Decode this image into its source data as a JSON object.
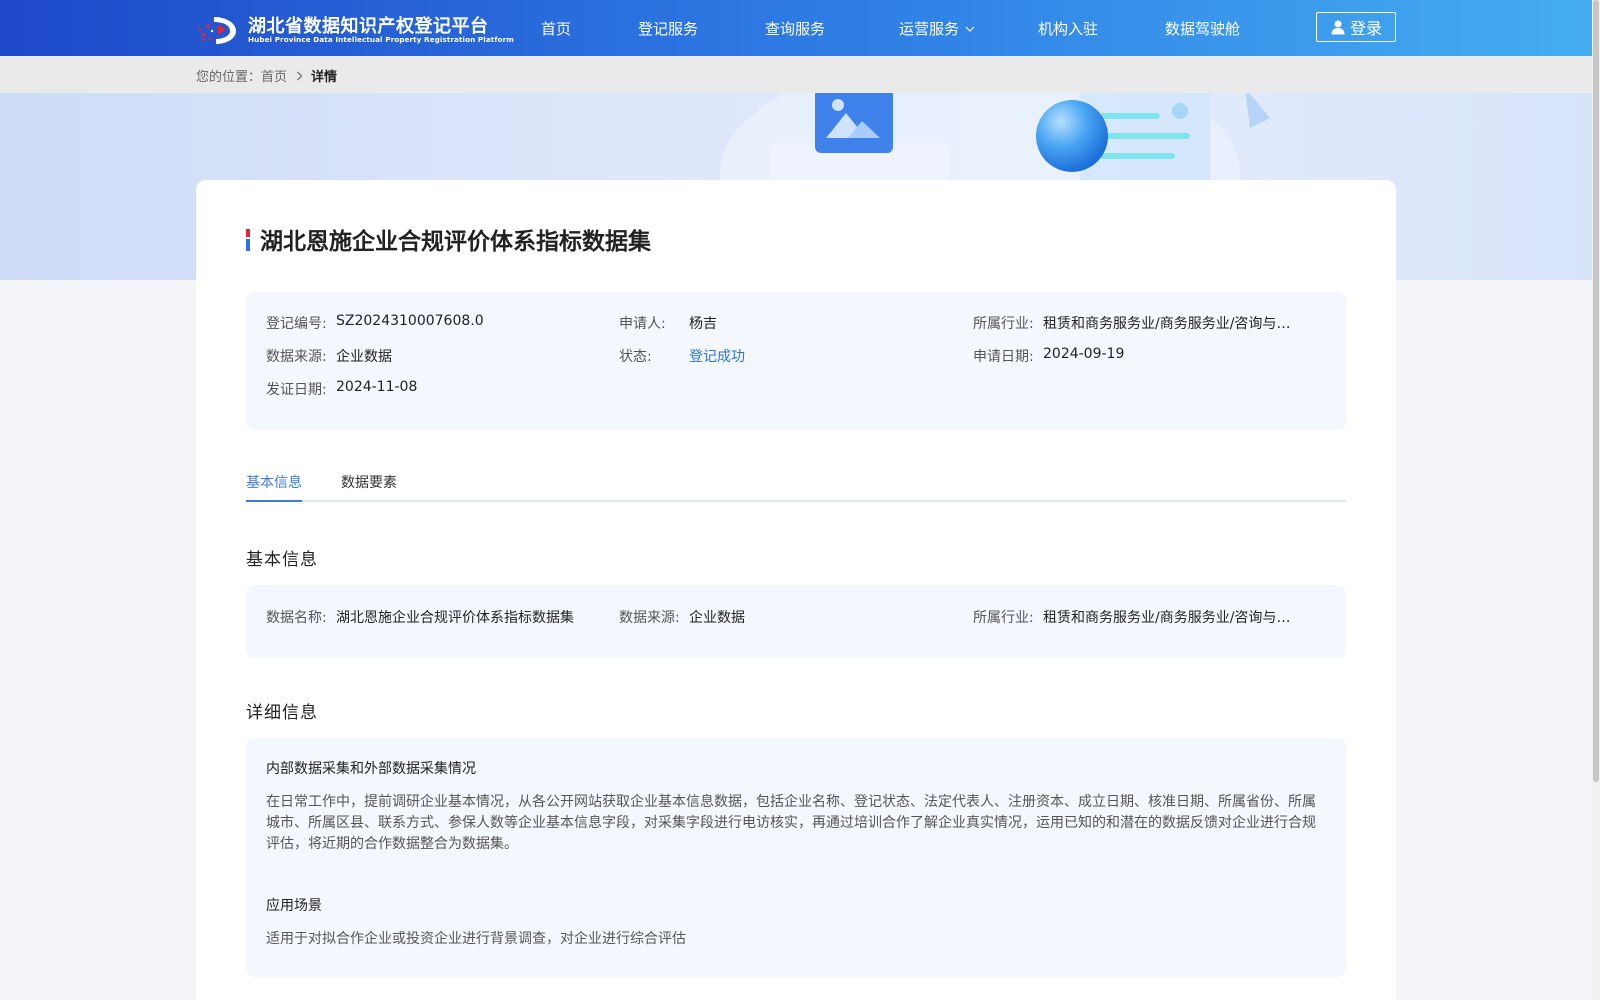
{
  "header": {
    "logo_title": "湖北省数据知识产权登记平台",
    "logo_subtitle": "Hubei Province Data Intellectual Property Registration Platform",
    "nav": [
      {
        "label": "首页"
      },
      {
        "label": "登记服务"
      },
      {
        "label": "查询服务"
      },
      {
        "label": "运营服务",
        "has_dropdown": true
      },
      {
        "label": "机构入驻"
      },
      {
        "label": "数据驾驶舱"
      }
    ],
    "login_label": "登录"
  },
  "breadcrumb": {
    "prefix": "您的位置：",
    "home": "首页",
    "current": "详情"
  },
  "page": {
    "title": "湖北恩施企业合规评价体系指标数据集"
  },
  "summary": {
    "reg_no": {
      "label": "登记编号:",
      "value": "SZ2024310007608.0"
    },
    "applicant": {
      "label": "申请人:",
      "value": "杨吉"
    },
    "industry": {
      "label": "所属行业:",
      "value": "租赁和商务服务业/商务服务业/咨询与调查"
    },
    "source": {
      "label": "数据来源:",
      "value": "企业数据"
    },
    "status": {
      "label": "状态:",
      "value": "登记成功"
    },
    "apply_date": {
      "label": "申请日期:",
      "value": "2024-09-19"
    },
    "issue_date": {
      "label": "发证日期:",
      "value": "2024-11-08"
    }
  },
  "tabs": [
    {
      "label": "基本信息",
      "active": true
    },
    {
      "label": "数据要素",
      "active": false
    }
  ],
  "basic": {
    "section_title": "基本信息",
    "name": {
      "label": "数据名称:",
      "value": "湖北恩施企业合规评价体系指标数据集"
    },
    "source": {
      "label": "数据来源:",
      "value": "企业数据"
    },
    "industry": {
      "label": "所属行业:",
      "value": "租赁和商务服务业/商务服务业/咨询与调查"
    }
  },
  "detail": {
    "section_title": "详细信息",
    "collection_heading": "内部数据采集和外部数据采集情况",
    "collection_text": "在日常工作中，提前调研企业基本情况，从各公开网站获取企业基本信息数据，包括企业名称、登记状态、法定代表人、注册资本、成立日期、核准日期、所属省份、所属城市、所属区县、联系方式、参保人数等企业基本信息字段，对采集字段进行电访核实，再通过培训合作了解企业真实情况，运用已知的和潜在的数据反馈对企业进行合规评估，将近期的合作数据整合为数据集。",
    "scenario_heading": "应用场景",
    "scenario_text": "适用于对拟合作企业或投资企业进行背景调查，对企业进行综合评估"
  },
  "colors": {
    "header_start": "#1e49c9",
    "header_end": "#45aef0",
    "accent": "#3b7bdf",
    "status": "#2a72e5",
    "panel_bg": "#f4f7fd"
  },
  "icons": {
    "logo": "hubei-logo-icon",
    "user": "user-icon",
    "chevron_down": "chevron-down-icon",
    "chevron_right": "chevron-right-icon"
  }
}
